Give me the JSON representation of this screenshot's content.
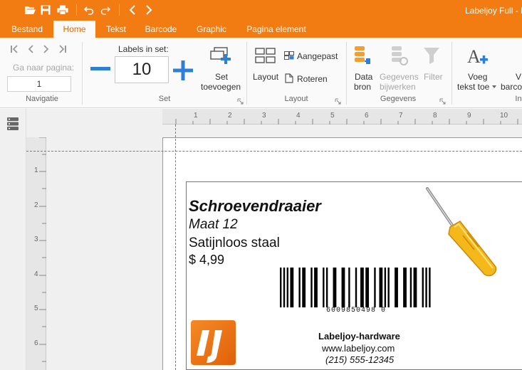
{
  "app": {
    "title": "Labeljoy Full - I"
  },
  "quick_access": [
    {
      "name": "open-folder-icon"
    },
    {
      "name": "save-icon"
    },
    {
      "name": "print-icon"
    },
    {
      "name": "undo-icon"
    },
    {
      "name": "redo-icon"
    },
    {
      "name": "nav-back-icon"
    },
    {
      "name": "nav-forward-icon"
    }
  ],
  "tabs": [
    {
      "label": "Bestand",
      "active": false
    },
    {
      "label": "Home",
      "active": true
    },
    {
      "label": "Tekst",
      "active": false
    },
    {
      "label": "Barcode",
      "active": false
    },
    {
      "label": "Graphic",
      "active": false
    },
    {
      "label": "Pagina element",
      "active": false
    }
  ],
  "ribbon": {
    "navigatie": {
      "group_label": "Navigatie",
      "goto_label": "Ga naar pagina:",
      "page_value": "1"
    },
    "set": {
      "group_label": "Set",
      "labels_in_set_label": "Labels in set:",
      "labels_in_set_value": "10",
      "add_set_label_1": "Set",
      "add_set_label_2": "toevoegen"
    },
    "layout": {
      "group_label": "Layout",
      "layout_label": "Layout",
      "custom_label": "Aangepast",
      "rotate_label": "Roteren"
    },
    "gegevens": {
      "group_label": "Gegevens",
      "source_label_1": "Data",
      "source_label_2": "bron",
      "update_label_1": "Gegevens",
      "update_label_2": "bijwerken",
      "filter_label": "Filter"
    },
    "insert": {
      "group_label": "In",
      "add_text_label_1": "Voeg",
      "add_text_label_2": "tekst toe",
      "add_barcode_label_1": "V",
      "add_barcode_label_2": "barco"
    }
  },
  "ruler": {
    "h_ticks": [
      "1",
      "2",
      "3",
      "4",
      "5",
      "6",
      "7",
      "8",
      "9",
      "10"
    ],
    "v_ticks": [
      "1",
      "2",
      "3",
      "4",
      "5",
      "6"
    ]
  },
  "label": {
    "product_name": "Schroevendraaier",
    "size": "Maat 12",
    "material": "Satijnloos staal",
    "price": "$ 4,99",
    "barcode_number": "6009850498 0",
    "barcode_digits": "6 0 0 9 8 5 0 4 9 8 0",
    "company": "Labeljoy-hardware",
    "website": "www.labeljoy.com",
    "phone": "(215) 555-12345"
  },
  "colors": {
    "accent": "#f27b12",
    "ribbon_bg": "#fafafa",
    "workspace_bg": "#f0f0f0",
    "icon_blue": "#2f7fd6",
    "icon_orange": "#f0a030"
  }
}
